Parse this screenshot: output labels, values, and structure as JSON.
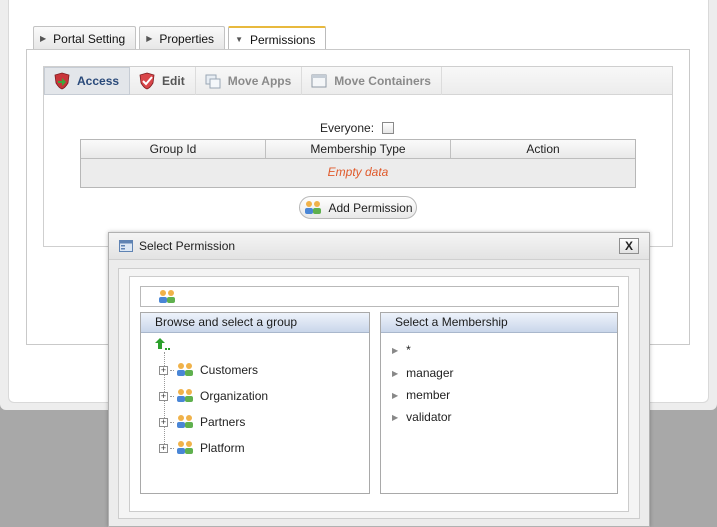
{
  "tabs": [
    {
      "label": "Portal Setting",
      "active": false
    },
    {
      "label": "Properties",
      "active": false
    },
    {
      "label": "Permissions",
      "active": true
    }
  ],
  "toolbar": {
    "access": "Access",
    "edit": "Edit",
    "move_apps": "Move Apps",
    "move_containers": "Move Containers"
  },
  "permissions": {
    "everyone_label": "Everyone:",
    "everyone_checked": false,
    "columns": [
      "Group Id",
      "Membership Type",
      "Action"
    ],
    "empty_text": "Empty data",
    "add_button": "Add Permission"
  },
  "dialog": {
    "title": "Select Permission",
    "close_label": "X",
    "group_panel_title": "Browse and select a group",
    "membership_panel_title": "Select a Membership",
    "groups": [
      "Customers",
      "Organization",
      "Partners",
      "Platform"
    ],
    "memberships": [
      "*",
      "manager",
      "member",
      "validator"
    ]
  },
  "colors": {
    "empty_text": "#e05a2b",
    "active_tab_accent": "#e8b93e",
    "panel_header": "#c9d6ea"
  }
}
